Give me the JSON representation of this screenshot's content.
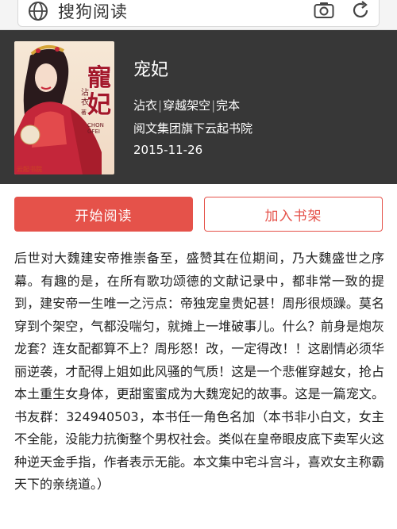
{
  "search": {
    "query": "搜狗阅读"
  },
  "book": {
    "title": "宠妃",
    "author": "沾衣",
    "category": "穿越架空",
    "status": "完本",
    "publisher": "阅文集团旗下云起书院",
    "date": "2015-11-26",
    "cover": {
      "title_text": "寵妃",
      "author_text": "沾衣",
      "author_suffix": "著",
      "roman_text": "CHON GFEI",
      "logo_text": "云起书院"
    }
  },
  "actions": {
    "start_label": "开始阅读",
    "shelf_label": "加入书架"
  },
  "description": "后世对大魏建安帝推崇备至，盛赞其在位期间，乃大魏盛世之序幕。有趣的是，在所有歌功颂德的文献记录中，都非常一致的提到，建安帝一生唯一之污点：帝独宠皇贵妃甚！周彤很烦躁。莫名穿到个架空，气都没喘匀，就摊上一堆破事儿。什么？前身是炮灰龙套？连女配都算不上？周彤怒！改，一定得改！！这剧情必须华丽逆袭，才配得上姐如此风骚的气质！这是一个悲催穿越女，抢占本土重生女身体，更甜蜜蜜成为大魏宠妃的故事。这是一篇宠文。书友群：324940503，本书任一角色名加（本书非小白文，女主不全能，没能力抗衡整个男权社会。类似在皇帝眼皮底下卖军火这种逆天金手指，作者表示无能。本文集中宅斗宫斗，喜欢女主称霸天下的亲绕道。）",
  "colors": {
    "accent": "#e5524a",
    "hero_bg": "#373737"
  }
}
